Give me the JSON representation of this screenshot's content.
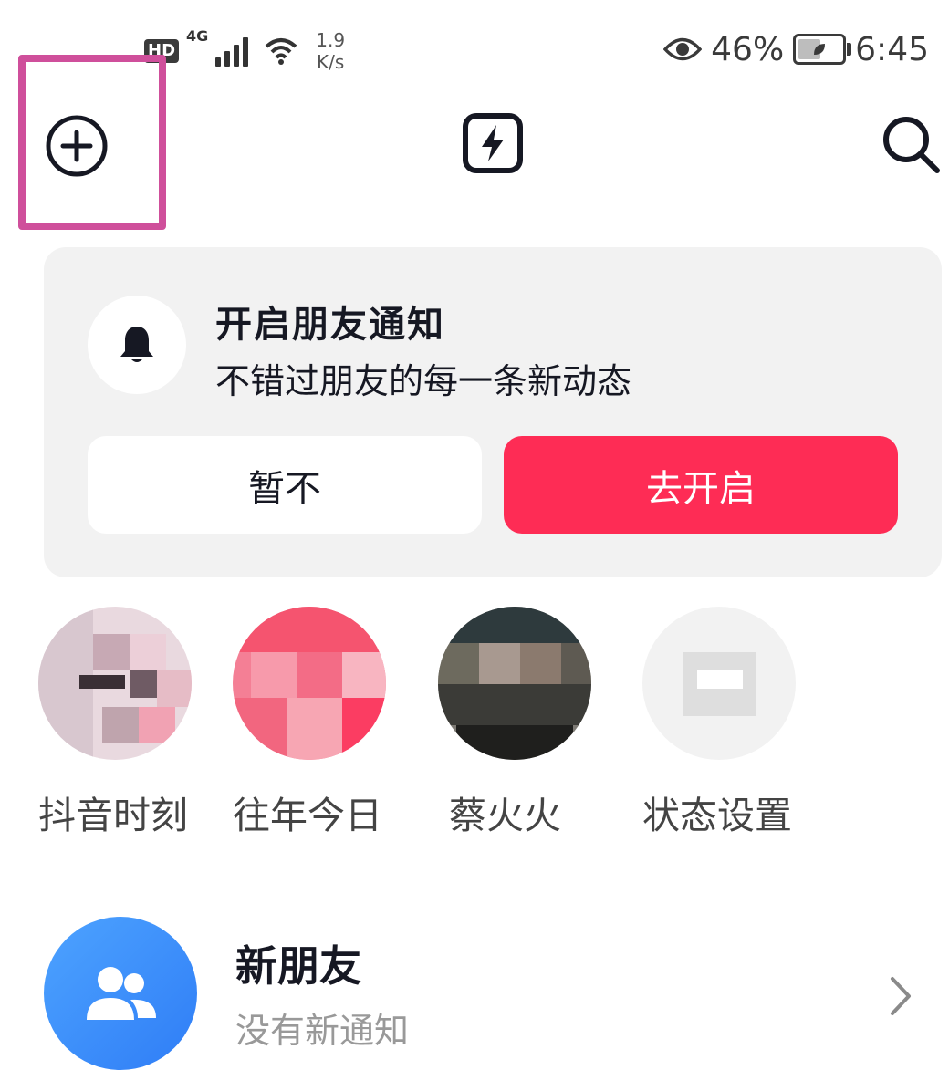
{
  "status_bar": {
    "hd": "HD",
    "network": "4G",
    "speed_value": "1.9",
    "speed_unit": "K/s",
    "battery": "46%",
    "time": "6:45",
    "icons": [
      "eye-icon",
      "signal-icon",
      "wifi-icon",
      "battery-icon"
    ]
  },
  "top_nav": {
    "icons": [
      "add-circle-icon",
      "flash-icon",
      "search-icon"
    ]
  },
  "notification_card": {
    "title": "开启朋友通知",
    "description": "不错过朋友的每一条新动态",
    "later_button": "暂不",
    "enable_button": "去开启",
    "icon": "bell-icon"
  },
  "stories": [
    {
      "label": "抖音时刻"
    },
    {
      "label": "往年今日"
    },
    {
      "label": "蔡火火"
    },
    {
      "label": "状态设置"
    }
  ],
  "new_friends": {
    "title": "新朋友",
    "subtitle": "没有新通知",
    "icon": "users-icon"
  },
  "colors": {
    "accent": "#fe2c55",
    "highlight_box": "#cf4f9b",
    "card_bg": "#f2f2f2",
    "new_friends_blue": "#2f7df6"
  }
}
